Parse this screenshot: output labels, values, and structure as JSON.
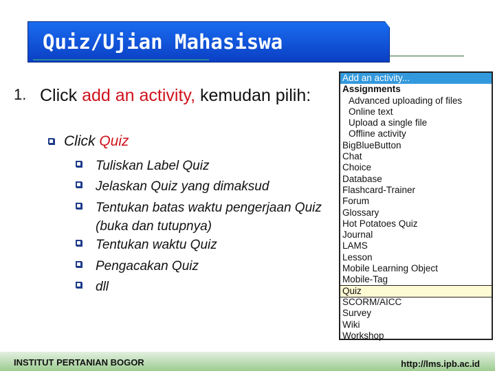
{
  "slide": {
    "title": "Quiz/Ujian Mahasiswa",
    "step_number": "1.",
    "step_pre": "Click ",
    "step_highlight": "add an activity,",
    "step_post": " kemudan pilih:",
    "sub_pre": "Click ",
    "sub_highlight": "Quiz",
    "bullets": [
      "Tuliskan Label Quiz",
      "Jelaskan  Quiz yang dimaksud",
      "Tentukan batas waktu pengerjaan Quiz (buka dan tutupnya)",
      "Tentukan waktu Quiz",
      "Pengacakan Quiz",
      "dll"
    ]
  },
  "menu": {
    "header": "Add an activity...",
    "group": "Assignments",
    "sub_items": [
      "Advanced uploading of files",
      "Online text",
      "Upload a single file",
      "Offline activity"
    ],
    "items": [
      "BigBlueButton",
      "Chat",
      "Choice",
      "Database",
      "Flashcard-Trainer",
      "Forum",
      "Glossary",
      "Hot Potatoes Quiz",
      "Journal",
      "LAMS",
      "Lesson",
      "Mobile Learning Object",
      "Mobile-Tag",
      "Quiz",
      "SCORM/AICC",
      "Survey",
      "Wiki",
      "Workshop"
    ],
    "selected": "Quiz"
  },
  "footer": {
    "left": "INSTITUT PERTANIAN BOGOR",
    "right": "http://lms.ipb.ac.id"
  },
  "colors": {
    "title_bg": "#1a5ce0",
    "highlight": "#d0121b",
    "menu_header": "#3399dd",
    "selected_bg": "#fefbd4"
  }
}
